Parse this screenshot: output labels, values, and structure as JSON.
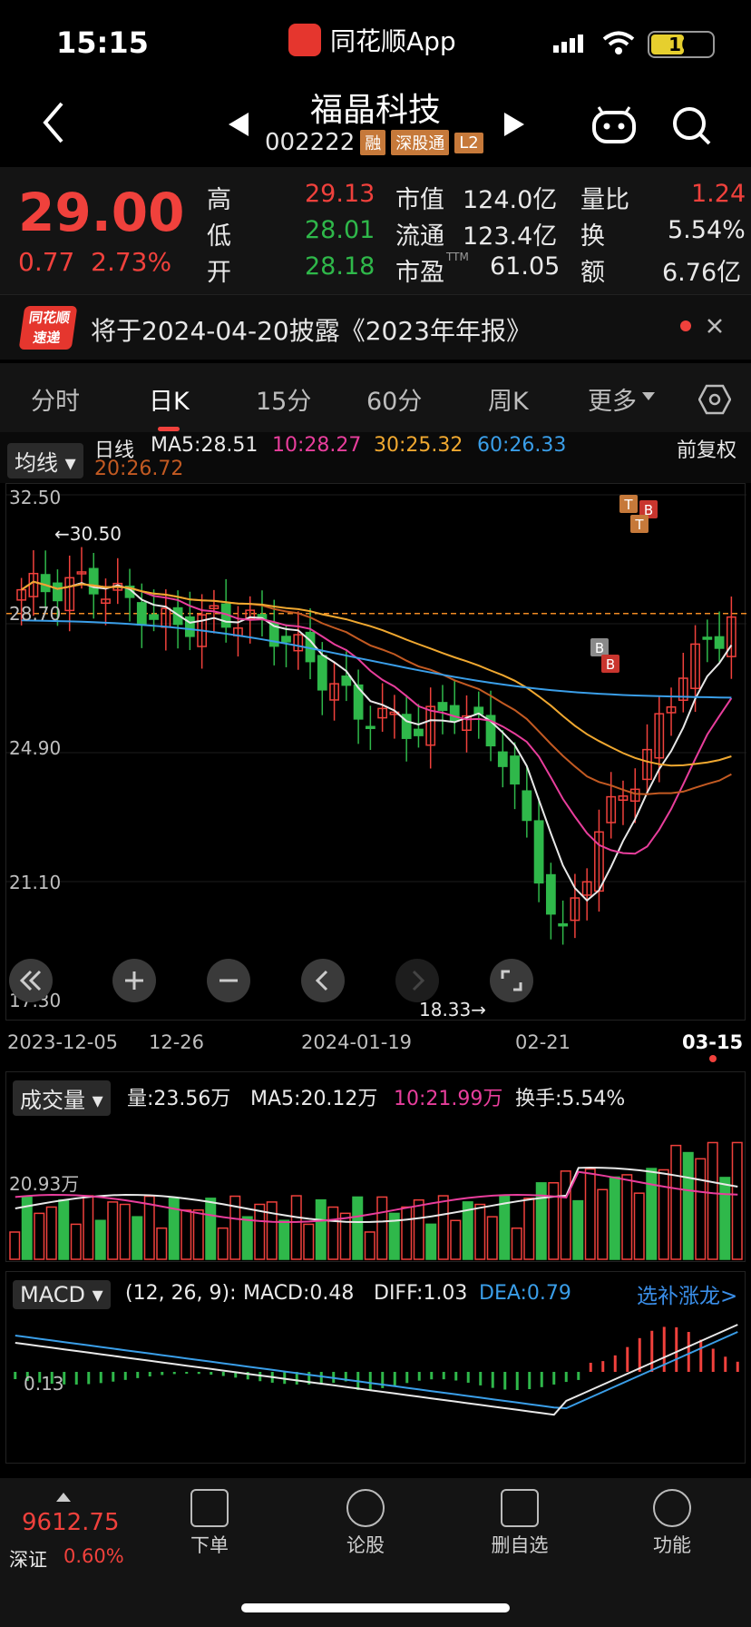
{
  "status": {
    "time": "15:15",
    "app_name": "同花顺App",
    "battery": "16"
  },
  "header": {
    "title": "福晶科技",
    "code": "002222",
    "tags": [
      "融",
      "深股通",
      "L2"
    ]
  },
  "quote": {
    "price": "29.00",
    "change": "0.77",
    "change_pct": "2.73%",
    "high_label": "高",
    "high": "29.13",
    "low_label": "低",
    "low": "28.01",
    "open_label": "开",
    "open": "28.18",
    "mktcap_label": "市值",
    "mktcap": "124.0亿",
    "float_label": "流通",
    "float": "123.4亿",
    "pe_label": "市盈",
    "pe_sup": "TTM",
    "pe": "61.05",
    "volratio_label": "量比",
    "volratio": "1.24",
    "turnover_label": "换",
    "turnover": "5.54%",
    "amount_label": "额",
    "amount": "6.76亿"
  },
  "notice": {
    "logo_top": "同花顺",
    "logo_bottom": "速递",
    "text": "将于2024-04-20披露《2023年年报》"
  },
  "tabs": [
    "分时",
    "日K",
    "15分",
    "60分",
    "周K",
    "更多"
  ],
  "ma_info": {
    "selector": "均线",
    "kind": "日线",
    "ma5": "MA5:28.51",
    "ma10": "10:28.27",
    "ma30": "30:25.32",
    "ma60": "60:26.33",
    "ma20": "20:26.72",
    "adjust": "前复权"
  },
  "chart": {
    "y_ticks": [
      "32.50",
      "28.70",
      "24.90",
      "21.10",
      "17.30"
    ],
    "x_ticks": [
      "2023-12-05",
      "12-26",
      "2024-01-19",
      "02-21",
      "03-15"
    ],
    "high_marker": "←30.50",
    "low_marker": "18.33→",
    "signals": [
      "T",
      "B",
      "T",
      "B",
      "B"
    ]
  },
  "volume": {
    "selector": "成交量",
    "vol": "量:23.56万",
    "ma5": "MA5:20.12万",
    "ma10": "10:21.99万",
    "turnover": "换手:5.54%",
    "y_tick": "20.93万"
  },
  "macd": {
    "selector": "MACD",
    "params": "(12, 26, 9):",
    "macd": "MACD:0.48",
    "diff": "DIFF:1.03",
    "dea": "DEA:0.79",
    "link": "选补涨龙>",
    "y_tick": "0.13"
  },
  "bottom": {
    "index_value": "9612.75",
    "index_name": "深证",
    "index_pct": "0.60%",
    "nav": [
      "下单",
      "论股",
      "删自选",
      "功能"
    ]
  },
  "colors": {
    "up": "#f0413c",
    "down": "#2fb84a",
    "ma5": "#e8e8e8",
    "ma10": "#e83e9c",
    "ma20": "#c35a22",
    "ma30": "#f0a830",
    "ma60": "#3a9ee8"
  }
}
